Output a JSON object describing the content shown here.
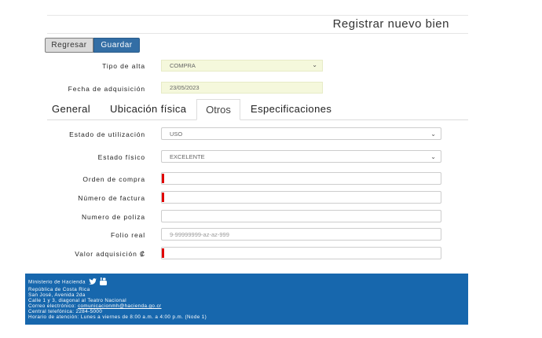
{
  "header": {
    "title": "Registrar nuevo bien"
  },
  "toolbar": {
    "back_label": "Regresar",
    "save_label": "Guardar"
  },
  "form_top": {
    "tipo_alta_label": "Tipo de alta",
    "tipo_alta_value": "COMPRA",
    "fecha_label": "Fecha de adquisición",
    "fecha_value": "23/05/2023"
  },
  "tabs": [
    {
      "label": "General"
    },
    {
      "label": "Ubicación física"
    },
    {
      "label": "Otros"
    },
    {
      "label": "Especificaciones"
    }
  ],
  "otros": {
    "estado_utilizacion_label": "Estado de utilización",
    "estado_utilizacion_value": "USO",
    "estado_fisico_label": "Estado físico",
    "estado_fisico_value": "EXCELENTE",
    "orden_compra_label": "Orden de compra",
    "numero_factura_label": "Número de factura",
    "numero_poliza_label": "Numero de poliza",
    "folio_real_label": "Folio real",
    "folio_real_placeholder": "9-99999999-az-az-999",
    "valor_adquisicion_label": "Valor adquisición ₡"
  },
  "footer": {
    "line1": "Ministerio de Hacienda",
    "line2": "República de Costa Rica",
    "line3": "San José, Avenida 2da",
    "line4": "Calle 1 y 3, diagonal al Teatro Nacional",
    "email_prefix": "Correo electrónico:",
    "email": "comunicacionmh@hacienda.go.cr",
    "phone": "Central telefónica: 2284-5000",
    "hours": "Horario de atención: Lunes a viernes de 8:00 a.m. a 4:00 p.m. (Node 1)",
    "icons": [
      "twitter-icon",
      "youtube-icon"
    ]
  }
}
